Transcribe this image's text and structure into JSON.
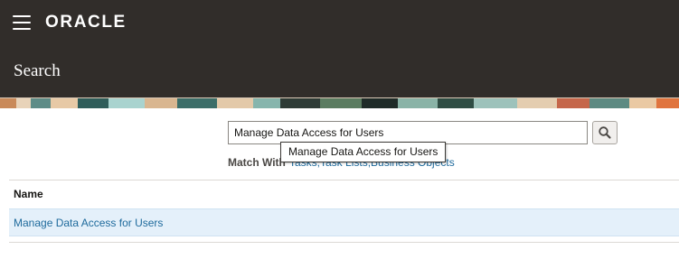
{
  "header": {
    "menu_icon": "hamburger-menu-icon",
    "logo_text": "ORACLE",
    "page_title": "Search"
  },
  "search": {
    "value": "Manage Data Access for Users",
    "button_icon": "search-icon",
    "tooltip": "Manage Data Access for Users",
    "match_with_label": "Match With",
    "match_with_value": "Tasks,Task Lists,Business Objects"
  },
  "results": {
    "columns": [
      "Name"
    ],
    "rows": [
      {
        "name": "Manage Data Access for Users"
      }
    ]
  },
  "colors": {
    "header_bg": "#312d2a",
    "link": "#1e6a9c",
    "selected_row": "#e4f0fa"
  }
}
